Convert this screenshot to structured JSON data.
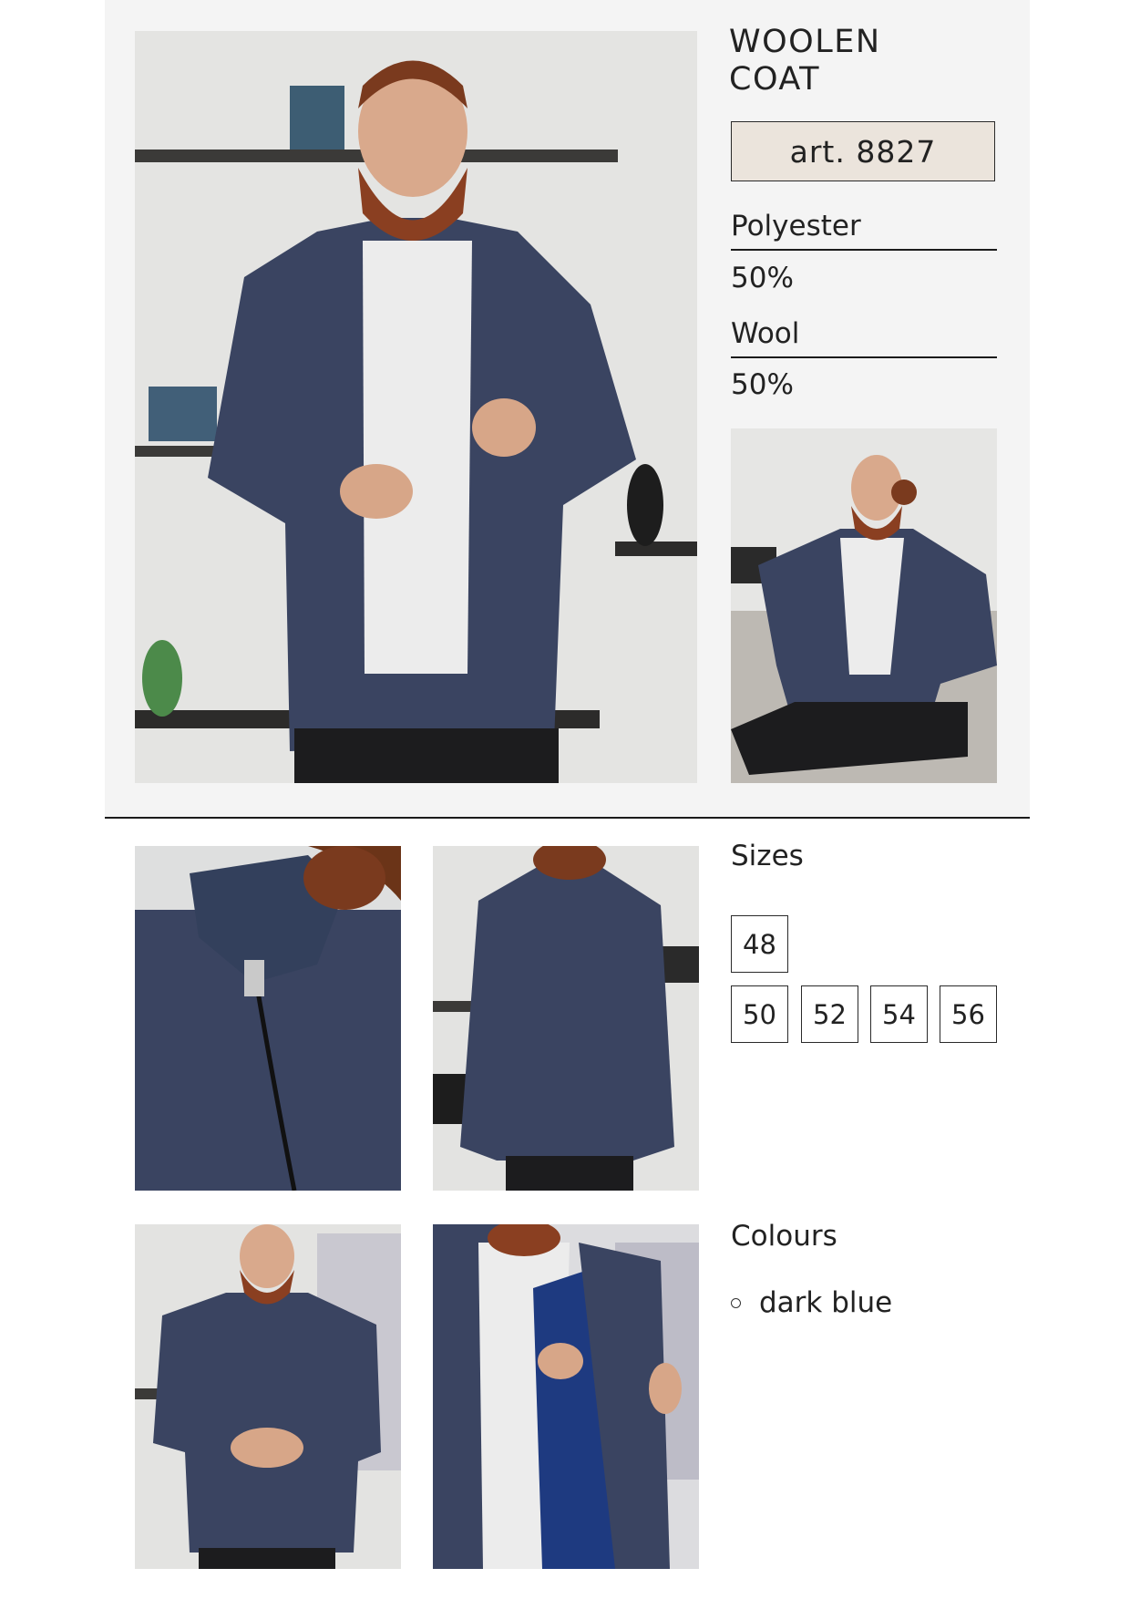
{
  "product": {
    "title_line1": "WOOLEN",
    "title_line2": "COAT",
    "article": "art. 8827"
  },
  "materials": [
    {
      "name": "Polyester",
      "percent": "50%"
    },
    {
      "name": "Wool",
      "percent": "50%"
    }
  ],
  "sizes": {
    "heading": "Sizes",
    "values": [
      "48",
      "50",
      "52",
      "54",
      "56"
    ]
  },
  "colours": {
    "heading": "Colours",
    "items": [
      {
        "label": "dark blue",
        "swatch": "#2f3a52"
      }
    ]
  },
  "photos": [
    {
      "name": "main-front-photo",
      "subject": "man in dark blue woolen coat, front view, hands at zipper"
    },
    {
      "name": "seated-photo",
      "subject": "man seated on sofa wearing coat"
    },
    {
      "name": "collar-detail-photo",
      "subject": "close-up of stand collar and diagonal zipper"
    },
    {
      "name": "back-view-photo",
      "subject": "back view of coat"
    },
    {
      "name": "front-hands-clasped-photo",
      "subject": "front view, hands clasped"
    },
    {
      "name": "lining-photo",
      "subject": "coat opened showing blue lining"
    }
  ],
  "colors": {
    "panel_bg": "#f4f4f4",
    "article_bg": "#ebe4dc",
    "coat_blue": "#3a4461",
    "text": "#1b1b1b"
  }
}
